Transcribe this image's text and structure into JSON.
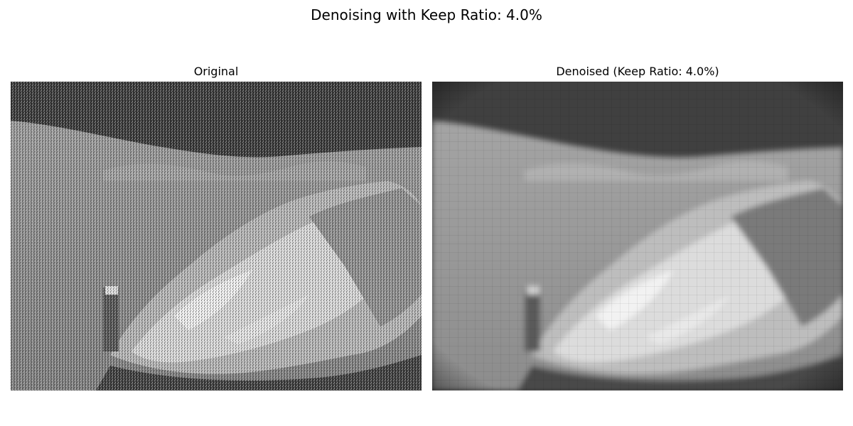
{
  "figure": {
    "title": "Denoising with Keep Ratio: 4.0%"
  },
  "panels": [
    {
      "title": "Original"
    },
    {
      "title": "Denoised (Keep Ratio: 4.0%)"
    }
  ]
}
